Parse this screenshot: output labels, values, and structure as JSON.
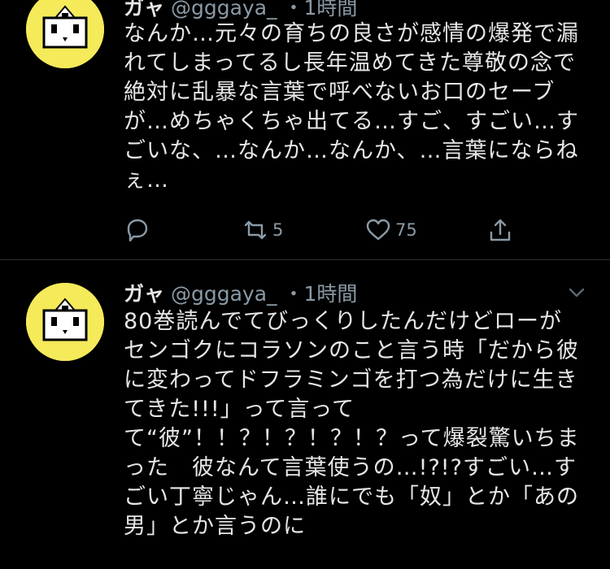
{
  "tweet1": {
    "display_name": "ガャ",
    "handle": "@gggaya_",
    "time": "・1時間",
    "lines": [
      "なんか…元々の育ちの良さが感情の爆発で漏",
      "れてしまってるし長年温めてきた尊敬の念で",
      "絶対に乱暴な言葉で呼べないお口のセーブ",
      "が…めちゃくちゃ出てる…すご、すごい…す",
      "ごいな、…なんか…なんか、…言葉にならね",
      "ぇ…"
    ],
    "retweet_count": "5",
    "like_count": "75"
  },
  "tweet2": {
    "display_name": "ガャ",
    "handle": "@gggaya_",
    "time": "・1時間",
    "lines": [
      "80巻読んでてびっくりしたんだけどローが",
      "センゴクにコラソンのこと言う時「だから彼",
      "に変わってドフラミンゴを打つ為だけに生き",
      "てきた!!!」って言って",
      "て“彼”！！？！？！？！？って爆裂驚いちま",
      "った　彼なんて言葉使うの…!?!?すごい…す",
      "ごい丁寧じゃん…誰にでも「奴」とか「あの",
      "男」とか言うのに"
    ]
  },
  "icons": {
    "reply": "reply-icon",
    "retweet": "retweet-icon",
    "like": "heart-icon",
    "share": "share-icon",
    "caret": "chevron-down-icon"
  },
  "colors": {
    "background": "#000000",
    "text": "#e6e6e6",
    "secondary": "#8a9aa6",
    "avatar_bg": "#f5ea5a"
  }
}
